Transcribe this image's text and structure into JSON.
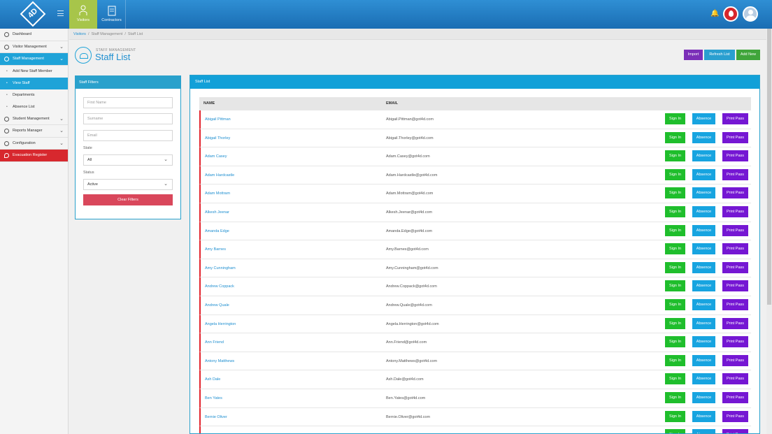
{
  "header": {
    "logo_text": "4D",
    "tabs": [
      {
        "label": "Visitors",
        "icon": "person-icon",
        "active": true
      },
      {
        "label": "Contractors",
        "icon": "clipboard-icon",
        "active": false
      }
    ],
    "accent_color": "#a7c54a"
  },
  "sidebar": {
    "items": [
      {
        "label": "Dashboard",
        "icon": "dashboard-icon",
        "chevron": false
      },
      {
        "label": "Visitor Management",
        "icon": "person-icon",
        "chevron": true
      },
      {
        "label": "Staff Management",
        "icon": "group-icon",
        "chevron": true,
        "active": true
      },
      {
        "label": "Add New Staff Member"
      },
      {
        "label": "View Staff",
        "current": true
      },
      {
        "label": "Departments"
      },
      {
        "label": "Absence List"
      },
      {
        "label": "Student Management",
        "icon": "student-icon",
        "chevron": true
      },
      {
        "label": "Reports Manager",
        "icon": "report-icon",
        "chevron": true
      },
      {
        "label": "Configuration",
        "icon": "gear-icon",
        "chevron": true
      },
      {
        "label": "Evacuation Register",
        "icon": "fire-icon",
        "chevron": false
      }
    ]
  },
  "breadcrumb": {
    "items": [
      "Visitors",
      "Staff Management",
      "Staff List"
    ]
  },
  "page": {
    "pre_title": "STAFF MANAGEMENT",
    "title": "Staff List",
    "buttons": {
      "import": "Import",
      "refresh": "Refresh List",
      "add": "Add New"
    }
  },
  "filters": {
    "title": "Staff Filters",
    "first_name_placeholder": "First Name",
    "surname_placeholder": "Surname",
    "email_placeholder": "Email",
    "state_label": "State",
    "state_value": "All",
    "status_label": "Status",
    "status_value": "Active",
    "clear_label": "Clear Filters"
  },
  "list": {
    "title": "Staff List",
    "columns": {
      "name": "NAME",
      "email": "EMAIL"
    },
    "actions": {
      "sign_in": "Sign In",
      "absence": "Absence",
      "print": "Print Pass"
    },
    "rows": [
      {
        "name": "Abigail Pittman",
        "email": "Abigail.Pittman@got4d.com"
      },
      {
        "name": "Abigail Thorley",
        "email": "Abigail.Thorley@got4d.com"
      },
      {
        "name": "Adam Casey",
        "email": "Adam.Casey@got4d.com"
      },
      {
        "name": "Adam Hardcastle",
        "email": "Adam.Hardcastle@got4d.com"
      },
      {
        "name": "Adam Mottram",
        "email": "Adam.Mottram@got4d.com"
      },
      {
        "name": "Alkesh Jeenar",
        "email": "Alkesh.Jeenar@got4d.com"
      },
      {
        "name": "Amanda Edge",
        "email": "Amanda.Edge@got4d.com"
      },
      {
        "name": "Amy Barnes",
        "email": "Amy.Barnes@got4d.com"
      },
      {
        "name": "Amy Cunningham",
        "email": "Amy.Cunningham@got4d.com"
      },
      {
        "name": "Andrew Coppack",
        "email": "Andrew.Coppack@got4d.com"
      },
      {
        "name": "Andrew Quale",
        "email": "Andrew.Quale@got4d.com"
      },
      {
        "name": "Angela Herrington",
        "email": "Angela.Herrington@got4d.com"
      },
      {
        "name": "Ann Friend",
        "email": "Ann.Friend@got4d.com"
      },
      {
        "name": "Antony Matthews",
        "email": "Antony.Matthews@got4d.com"
      },
      {
        "name": "Ash Dale",
        "email": "Ash.Dale@got4d.com"
      },
      {
        "name": "Ben Yates",
        "email": "Ben.Yates@got4d.com"
      },
      {
        "name": "Bernie Oliver",
        "email": "Bernie.Oliver@got4d.com"
      },
      {
        "name": "",
        "email": ""
      }
    ]
  },
  "colors": {
    "sign_in": "#1fbe2c",
    "absence": "#17a4e0",
    "print_pass": "#7517d3",
    "row_marker": "#e2242d"
  }
}
